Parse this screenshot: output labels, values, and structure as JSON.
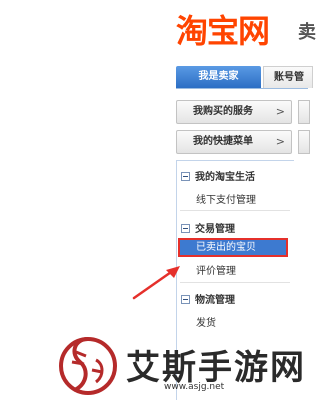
{
  "logo": {
    "brand": "淘宝网",
    "suffix": "卖"
  },
  "tabs": {
    "active": "我是卖家",
    "inactive": "账号管"
  },
  "buttons": {
    "services": {
      "label": "我购买的服务",
      "arrow": ">"
    },
    "quick_menu": {
      "label": "我的快捷菜单",
      "arrow": ">"
    }
  },
  "menu": {
    "sections": [
      {
        "title": "我的淘宝生活",
        "items": [
          "线下支付管理"
        ]
      },
      {
        "title": "交易管理",
        "items": [
          "已卖出的宝贝",
          "评价管理"
        ]
      },
      {
        "title": "物流管理",
        "items": [
          "发货"
        ]
      }
    ]
  },
  "watermark": {
    "title": "艾斯手游网",
    "url": "www.asjg.net"
  },
  "colors": {
    "brand": "#ff4400",
    "selected": "#3d7ad0",
    "highlight": "#e5302b",
    "tab_active": "#3c7fd4"
  }
}
